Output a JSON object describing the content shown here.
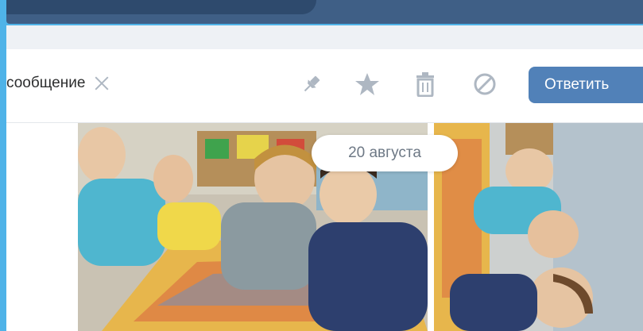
{
  "toolbar": {
    "selection_label": "сообщение",
    "reply_label": "Ответить",
    "icons": [
      "pin-icon",
      "star-icon",
      "trash-icon",
      "block-icon",
      "close-icon"
    ]
  },
  "date_divider": "20 августа",
  "colors": {
    "topbar": "#3f5f86",
    "frame": "#4fb3e8",
    "reply_button": "#5181b8",
    "icon_gray": "#aeb7c2"
  }
}
